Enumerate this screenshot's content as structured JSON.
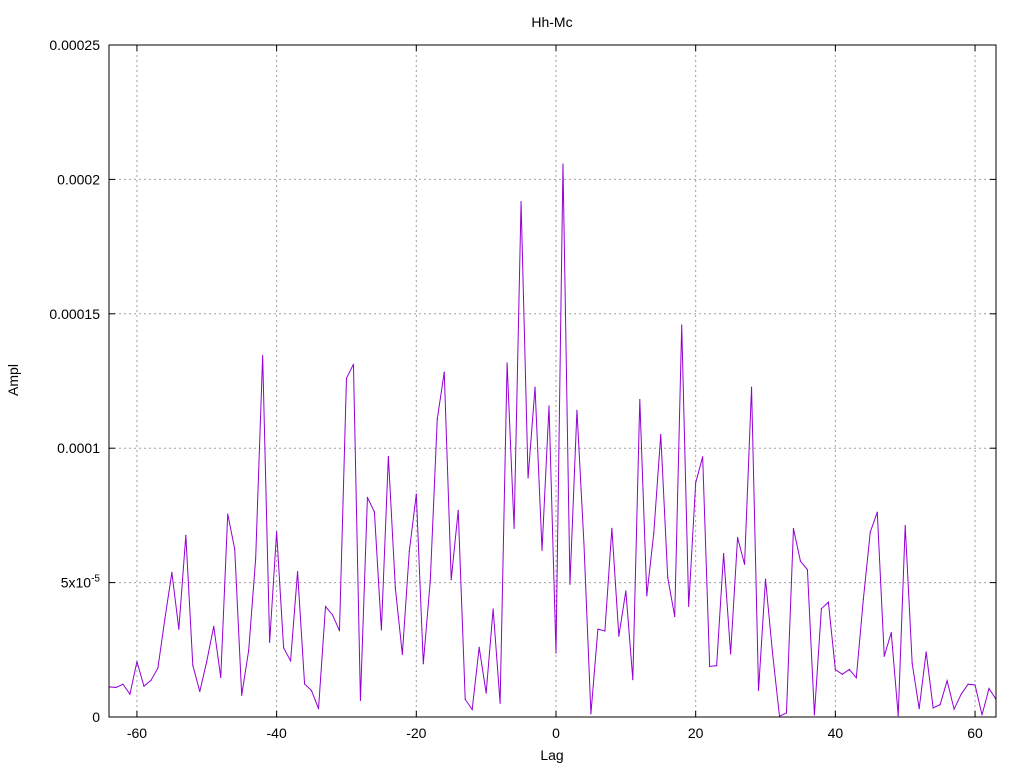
{
  "chart_data": {
    "type": "line",
    "title": "Hh-Mc",
    "xlabel": "Lag",
    "ylabel": "Ampl",
    "xlim": [
      -64,
      63
    ],
    "ylim": [
      0,
      0.00025
    ],
    "grid": true,
    "x_ticks": [
      -60,
      -40,
      -20,
      0,
      20,
      40,
      60
    ],
    "x_tick_labels": [
      "-60",
      "-40",
      "-20",
      "0",
      "20",
      "40",
      "60"
    ],
    "y_ticks": [
      0,
      5e-05,
      0.0001,
      0.00015,
      0.0002,
      0.00025
    ],
    "y_tick_labels": [
      "0",
      "5x10",
      "0.0001",
      "0.00015",
      "0.0002",
      "0.00025"
    ],
    "y_tick_exponent": "-5",
    "series_color": "#9400d3",
    "series": [
      {
        "x": [
          -64,
          -63,
          -62,
          -61,
          -60,
          -59,
          -58,
          -57,
          -56,
          -55,
          -54,
          -53,
          -52,
          -51,
          -50,
          -49,
          -48,
          -47,
          -46,
          -45,
          -44,
          -43,
          -42,
          -41,
          -40,
          -39,
          -38,
          -37,
          -36,
          -35,
          -34,
          -33,
          -32,
          -31,
          -30,
          -29,
          -28,
          -27,
          -26,
          -25,
          -24,
          -23,
          -22,
          -21,
          -20,
          -19,
          -18,
          -17,
          -16,
          -15,
          -14,
          -13,
          -12,
          -11,
          -10,
          -9,
          -8,
          -7,
          -6,
          -5,
          -4,
          -3,
          -2,
          -1,
          0,
          1,
          2,
          3,
          4,
          5,
          6,
          7,
          8,
          9,
          10,
          11,
          12,
          13,
          14,
          15,
          16,
          17,
          18,
          19,
          20,
          21,
          22,
          23,
          24,
          25,
          26,
          27,
          28,
          29,
          30,
          31,
          32,
          33,
          34,
          35,
          36,
          37,
          38,
          39,
          40,
          41,
          42,
          43,
          44,
          45,
          46,
          47,
          48,
          49,
          50,
          51,
          52,
          53,
          54,
          55,
          56,
          57,
          58,
          59,
          60,
          61,
          62,
          63
        ],
        "values": [
          1.12e-05,
          1.1e-05,
          1.22e-05,
          8.5e-06,
          2.06e-05,
          1.15e-05,
          1.36e-05,
          1.82e-05,
          3.65e-05,
          5.38e-05,
          3.27e-05,
          6.76e-05,
          1.92e-05,
          9.5e-06,
          2.08e-05,
          3.37e-05,
          1.47e-05,
          7.55e-05,
          6.25e-05,
          8.1e-06,
          2.48e-05,
          5.9e-05,
          0.0001344,
          2.78e-05,
          6.89e-05,
          2.57e-05,
          2.09e-05,
          5.41e-05,
          1.23e-05,
          9.8e-06,
          3.1e-06,
          4.11e-05,
          3.8e-05,
          3.21e-05,
          0.000126,
          0.0001312,
          6.2e-06,
          8.17e-05,
          7.63e-05,
          3.24e-05,
          9.69e-05,
          4.8e-05,
          2.33e-05,
          6.17e-05,
          8.29e-05,
          1.98e-05,
          5.07e-05,
          0.0001108,
          0.0001283,
          5.11e-05,
          7.69e-05,
          6.6e-06,
          2.8e-06,
          2.59e-05,
          8.9e-06,
          4.02e-05,
          5.1e-06,
          0.0001317,
          7.02e-05,
          0.0001917,
          8.89e-05,
          0.0001227,
          6.2e-05,
          0.0001157,
          2.38e-05,
          0.0002057,
          4.94e-05,
          0.0001141,
          6.46e-05,
          1.2e-06,
          3.27e-05,
          3.2e-05,
          7.02e-05,
          3.01e-05,
          4.69e-05,
          1.39e-05,
          0.0001181,
          4.51e-05,
          6.84e-05,
          0.0001051,
          5.18e-05,
          3.74e-05,
          0.0001458,
          4.12e-05,
          8.71e-05,
          9.68e-05,
          1.88e-05,
          1.91e-05,
          6.08e-05,
          2.35e-05,
          6.68e-05,
          5.68e-05,
          0.0001227,
          9.9e-06,
          5.13e-05,
          2.39e-05,
          3e-07,
          1.5e-06,
          7.01e-05,
          5.8e-05,
          5.48e-05,
          8e-07,
          4.03e-05,
          4.27e-05,
          1.76e-05,
          1.59e-05,
          1.77e-05,
          1.46e-05,
          4.36e-05,
          6.88e-05,
          7.62e-05,
          2.26e-05,
          3.14e-05,
          5e-07,
          7.12e-05,
          1.99e-05,
          3.1e-06,
          2.42e-05,
          3.4e-06,
          4.6e-06,
          1.35e-05,
          2.9e-06,
          8.4e-06,
          1.22e-05,
          1.19e-05,
          8e-07,
          1.06e-05,
          6.6e-06
        ]
      }
    ]
  }
}
